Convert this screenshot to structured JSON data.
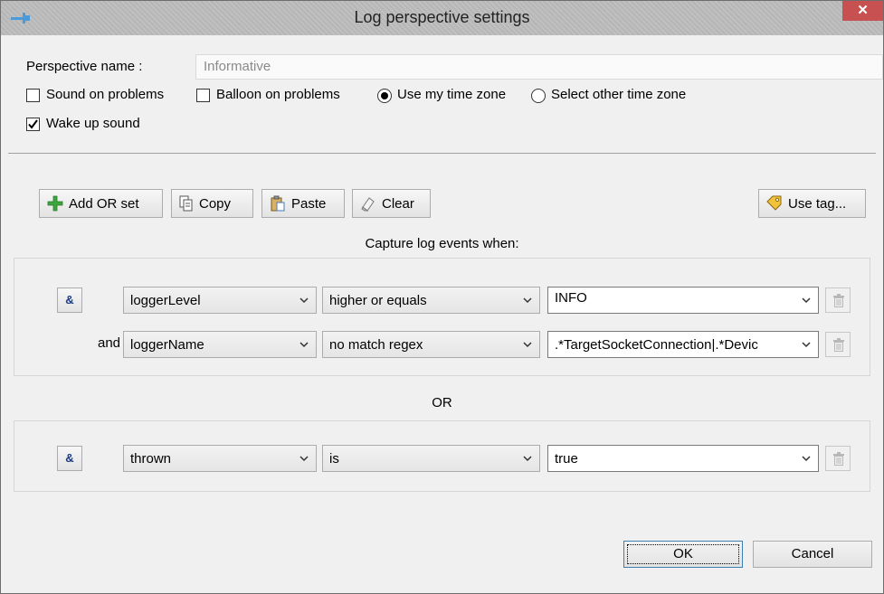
{
  "window": {
    "title": "Log perspective settings",
    "close_glyph": "✕"
  },
  "perspective": {
    "label": "Perspective name :",
    "value": "Informative"
  },
  "options": {
    "sound_on_problems": {
      "label": "Sound on problems",
      "checked": false
    },
    "balloon_on_problems": {
      "label": "Balloon on problems",
      "checked": false
    },
    "use_my_time_zone": {
      "label": "Use my time zone",
      "selected": true
    },
    "select_other_time_zone": {
      "label": "Select other time zone",
      "selected": false
    },
    "wake_up_sound": {
      "label": "Wake up sound",
      "checked": true
    }
  },
  "toolbar": {
    "add_or_set": {
      "label": "Add OR set",
      "icon": "plus-icon"
    },
    "copy": {
      "label": "Copy",
      "icon": "copy-icon"
    },
    "paste": {
      "label": "Paste",
      "icon": "paste-icon"
    },
    "clear": {
      "label": "Clear",
      "icon": "eraser-icon"
    },
    "use_tag": {
      "label": "Use tag...",
      "icon": "tag-icon"
    }
  },
  "capture_label": "Capture log events when:",
  "or_label": "OR",
  "groups": [
    {
      "group_button": "&",
      "conditions": [
        {
          "prefix": "",
          "field": "loggerLevel",
          "operator": "higher or equals",
          "value": "INFO"
        },
        {
          "prefix": "and",
          "field": "loggerName",
          "operator": "no match regex",
          "value": ".*TargetSocketConnection|.*Devic"
        }
      ]
    },
    {
      "group_button": "&",
      "conditions": [
        {
          "prefix": "",
          "field": "thrown",
          "operator": "is",
          "value": "true"
        }
      ]
    }
  ],
  "dialog_buttons": {
    "ok": "OK",
    "cancel": "Cancel"
  },
  "colors": {
    "close_button": "#c75050",
    "titlebar": "#bcbcbc",
    "plus_icon": "#3ca53c"
  }
}
